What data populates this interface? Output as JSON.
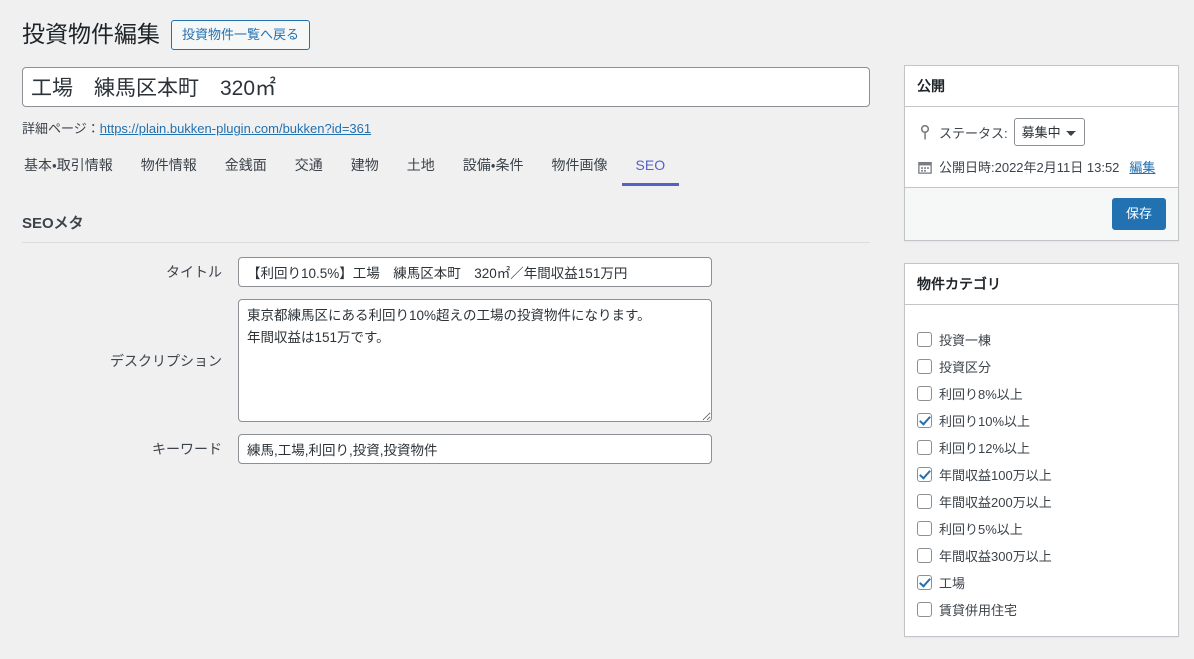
{
  "header": {
    "page_title": "投資物件編集",
    "back_button_label": "投資物件一覧へ戻る",
    "post_title_value": "工場　練馬区本町　320㎡",
    "permalink_label": "詳細ページ：",
    "permalink_url": "https://plain.bukken-plugin.com/bukken?id=361"
  },
  "tabs": [
    {
      "label": "基本・取引情報",
      "active": false
    },
    {
      "label": "物件情報",
      "active": false
    },
    {
      "label": "金銭面",
      "active": false
    },
    {
      "label": "交通",
      "active": false
    },
    {
      "label": "建物",
      "active": false
    },
    {
      "label": "土地",
      "active": false
    },
    {
      "label": "設備・条件",
      "active": false
    },
    {
      "label": "物件画像",
      "active": false
    },
    {
      "label": "SEO",
      "active": true
    }
  ],
  "seo": {
    "section_title": "SEOメタ",
    "title_label": "タイトル",
    "title_value": "【利回り10.5%】工場　練馬区本町　320㎡／年間収益151万円",
    "description_label": "デスクリプション",
    "description_value": "東京都練馬区にある利回り10%超えの工場の投資物件になります。\n年間収益は151万です。",
    "keywords_label": "キーワード",
    "keywords_value": "練馬,工場,利回り,投資,投資物件"
  },
  "publish_panel": {
    "title": "公開",
    "status_label": "ステータス:",
    "status_value": "募集中",
    "status_options": [
      "募集中"
    ],
    "date_label": "公開日時:2022年2月11日 13:52",
    "date_edit_link": "編集",
    "save_label": "保存"
  },
  "category_panel": {
    "title": "物件カテゴリ",
    "items": [
      {
        "label": "投資一棟",
        "checked": false
      },
      {
        "label": "投資区分",
        "checked": false
      },
      {
        "label": "利回り8%以上",
        "checked": false
      },
      {
        "label": "利回り10%以上",
        "checked": true
      },
      {
        "label": "利回り12%以上",
        "checked": false
      },
      {
        "label": "年間収益100万以上",
        "checked": true
      },
      {
        "label": "年間収益200万以上",
        "checked": false
      },
      {
        "label": "利回り5%以上",
        "checked": false
      },
      {
        "label": "年間収益300万以上",
        "checked": false
      },
      {
        "label": "工場",
        "checked": true
      },
      {
        "label": "賃貸併用住宅",
        "checked": false
      }
    ]
  },
  "colors": {
    "page_background": "#f0f0f1",
    "accent_blue": "#2271b1",
    "tab_active": "#5661c4",
    "text": "#3c434a"
  }
}
